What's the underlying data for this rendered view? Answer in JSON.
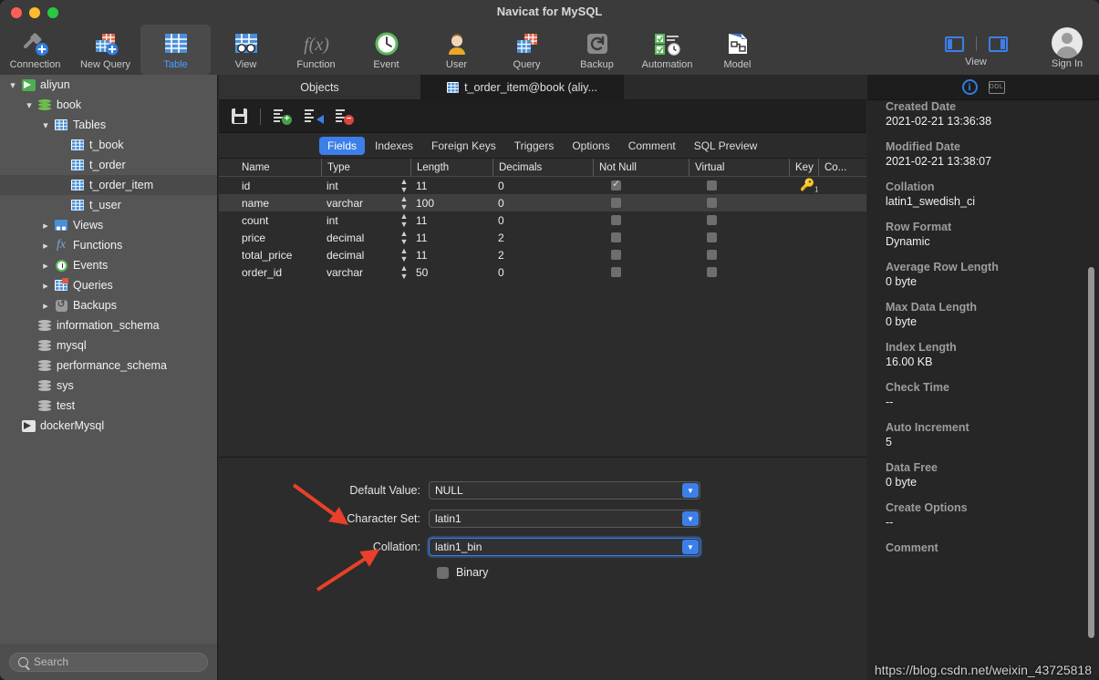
{
  "window": {
    "title": "Navicat for MySQL"
  },
  "toolbar": {
    "items": [
      {
        "label": "Connection",
        "icon": "connection-icon"
      },
      {
        "label": "New Query",
        "icon": "new-query-icon"
      },
      {
        "label": "Table",
        "icon": "table-icon"
      },
      {
        "label": "View",
        "icon": "view-icon"
      },
      {
        "label": "Function",
        "icon": "function-icon"
      },
      {
        "label": "Event",
        "icon": "event-icon"
      },
      {
        "label": "User",
        "icon": "user-icon"
      },
      {
        "label": "Query",
        "icon": "query-icon"
      },
      {
        "label": "Backup",
        "icon": "backup-icon"
      },
      {
        "label": "Automation",
        "icon": "automation-icon"
      },
      {
        "label": "Model",
        "icon": "model-icon"
      }
    ],
    "active_item": "Table",
    "view_label": "View",
    "signin_label": "Sign In"
  },
  "sidebar": {
    "tree": [
      {
        "label": "aliyun",
        "indent": 0,
        "chevron": "down",
        "icon": "connection-green-icon",
        "selected": false
      },
      {
        "label": "book",
        "indent": 1,
        "chevron": "down",
        "icon": "database-green-icon",
        "selected": false
      },
      {
        "label": "Tables",
        "indent": 2,
        "chevron": "down",
        "icon": "tables-icon",
        "selected": false
      },
      {
        "label": "t_book",
        "indent": 3,
        "chevron": "none",
        "icon": "table-icon",
        "selected": false
      },
      {
        "label": "t_order",
        "indent": 3,
        "chevron": "none",
        "icon": "table-icon",
        "selected": false
      },
      {
        "label": "t_order_item",
        "indent": 3,
        "chevron": "none",
        "icon": "table-icon",
        "selected": true
      },
      {
        "label": "t_user",
        "indent": 3,
        "chevron": "none",
        "icon": "table-icon",
        "selected": false
      },
      {
        "label": "Views",
        "indent": 2,
        "chevron": "right",
        "icon": "views-icon",
        "selected": false
      },
      {
        "label": "Functions",
        "indent": 2,
        "chevron": "right",
        "icon": "function-icon",
        "selected": false
      },
      {
        "label": "Events",
        "indent": 2,
        "chevron": "right",
        "icon": "events-clock-icon",
        "selected": false
      },
      {
        "label": "Queries",
        "indent": 2,
        "chevron": "right",
        "icon": "queries-icon",
        "selected": false
      },
      {
        "label": "Backups",
        "indent": 2,
        "chevron": "right",
        "icon": "backups-icon",
        "selected": false
      },
      {
        "label": "information_schema",
        "indent": 1,
        "chevron": "none",
        "icon": "database-gray-icon",
        "selected": false
      },
      {
        "label": "mysql",
        "indent": 1,
        "chevron": "none",
        "icon": "database-gray-icon",
        "selected": false
      },
      {
        "label": "performance_schema",
        "indent": 1,
        "chevron": "none",
        "icon": "database-gray-icon",
        "selected": false
      },
      {
        "label": "sys",
        "indent": 1,
        "chevron": "none",
        "icon": "database-gray-icon",
        "selected": false
      },
      {
        "label": "test",
        "indent": 1,
        "chevron": "none",
        "icon": "database-gray-icon",
        "selected": false
      },
      {
        "label": "dockerMysql",
        "indent": 0,
        "chevron": "none",
        "icon": "connection-gray-icon",
        "selected": false
      }
    ],
    "search_placeholder": "Search"
  },
  "editor": {
    "tabs": [
      {
        "label": "Objects",
        "active": false
      },
      {
        "label": "t_order_item@book (aliy...",
        "active": true
      }
    ],
    "toolbar_icons": [
      {
        "name": "save-icon"
      },
      {
        "name": "add-field-icon"
      },
      {
        "name": "insert-field-icon"
      },
      {
        "name": "delete-field-icon"
      }
    ],
    "subtabs": [
      {
        "label": "Fields",
        "active": true
      },
      {
        "label": "Indexes",
        "active": false
      },
      {
        "label": "Foreign Keys",
        "active": false
      },
      {
        "label": "Triggers",
        "active": false
      },
      {
        "label": "Options",
        "active": false
      },
      {
        "label": "Comment",
        "active": false
      },
      {
        "label": "SQL Preview",
        "active": false
      }
    ],
    "grid": {
      "columns": [
        "Name",
        "Type",
        "Length",
        "Decimals",
        "Not Null",
        "Virtual",
        "Key",
        "Co..."
      ],
      "rows": [
        {
          "name": "id",
          "type": "int",
          "length": "11",
          "decimals": "0",
          "not_null": true,
          "virtual": false,
          "key": "1",
          "selected": false
        },
        {
          "name": "name",
          "type": "varchar",
          "length": "100",
          "decimals": "0",
          "not_null": false,
          "virtual": false,
          "key": "",
          "selected": true
        },
        {
          "name": "count",
          "type": "int",
          "length": "11",
          "decimals": "0",
          "not_null": false,
          "virtual": false,
          "key": "",
          "selected": false
        },
        {
          "name": "price",
          "type": "decimal",
          "length": "11",
          "decimals": "2",
          "not_null": false,
          "virtual": false,
          "key": "",
          "selected": false
        },
        {
          "name": "total_price",
          "type": "decimal",
          "length": "11",
          "decimals": "2",
          "not_null": false,
          "virtual": false,
          "key": "",
          "selected": false
        },
        {
          "name": "order_id",
          "type": "varchar",
          "length": "50",
          "decimals": "0",
          "not_null": false,
          "virtual": false,
          "key": "",
          "selected": false
        }
      ]
    },
    "detail": {
      "default_value_label": "Default Value:",
      "default_value": "NULL",
      "character_set_label": "Character Set:",
      "character_set": "latin1",
      "collation_label": "Collation:",
      "collation": "latin1_bin",
      "binary_label": "Binary",
      "binary_checked": false
    }
  },
  "info_panel": {
    "tabs": [
      {
        "name": "info-icon",
        "active": true
      },
      {
        "name": "ddl-icon",
        "active": false
      }
    ],
    "items": [
      {
        "key": "Created Date",
        "value": "2021-02-21 13:36:38"
      },
      {
        "key": "Modified Date",
        "value": "2021-02-21 13:38:07"
      },
      {
        "key": "Collation",
        "value": "latin1_swedish_ci"
      },
      {
        "key": "Row Format",
        "value": "Dynamic"
      },
      {
        "key": "Average Row Length",
        "value": "0 byte"
      },
      {
        "key": "Max Data Length",
        "value": "0 byte"
      },
      {
        "key": "Index Length",
        "value": "16.00 KB"
      },
      {
        "key": "Check Time",
        "value": "--"
      },
      {
        "key": "Auto Increment",
        "value": "5"
      },
      {
        "key": "Data Free",
        "value": "0 byte"
      },
      {
        "key": "Create Options",
        "value": "--"
      },
      {
        "key": "Comment",
        "value": ""
      }
    ]
  },
  "watermark": {
    "text": "https://blog.csdn.net/weixin_43725818"
  },
  "colors": {
    "accent": "#3c7fe8",
    "window_bg": "#2c2c2c",
    "sidebar_bg": "#555555",
    "annotation_arrow": "#e8402a"
  }
}
